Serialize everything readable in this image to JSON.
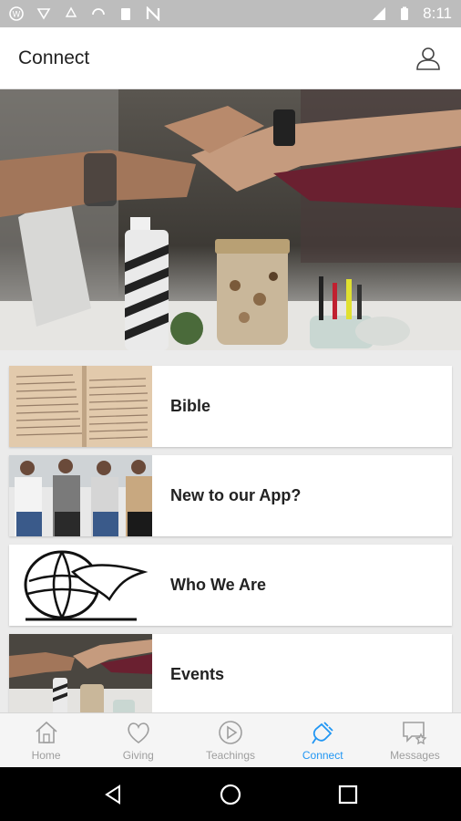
{
  "status_bar": {
    "time": "8:11",
    "background": "#bdbdbd"
  },
  "app_bar": {
    "title": "Connect",
    "profile_icon": "person-icon"
  },
  "hero": {
    "image": "team-fist-bump-photo"
  },
  "list": {
    "items": [
      {
        "label": "Bible",
        "thumbnail": "open-bible-photo"
      },
      {
        "label": "New to our App?",
        "thumbnail": "people-with-phones-photo"
      },
      {
        "label": "Who We Are",
        "thumbnail": "globe-dove-logo"
      },
      {
        "label": "Events",
        "thumbnail": "team-fist-bump-photo"
      }
    ]
  },
  "bottom_nav": {
    "accent": "#2196f3",
    "inactive": "#9e9e9e",
    "items": [
      {
        "label": "Home",
        "icon": "home-icon",
        "active": false
      },
      {
        "label": "Giving",
        "icon": "heart-icon",
        "active": false
      },
      {
        "label": "Teachings",
        "icon": "play-circle-icon",
        "active": false
      },
      {
        "label": "Connect",
        "icon": "plug-icon",
        "active": true
      },
      {
        "label": "Messages",
        "icon": "message-star-icon",
        "active": false
      }
    ]
  }
}
